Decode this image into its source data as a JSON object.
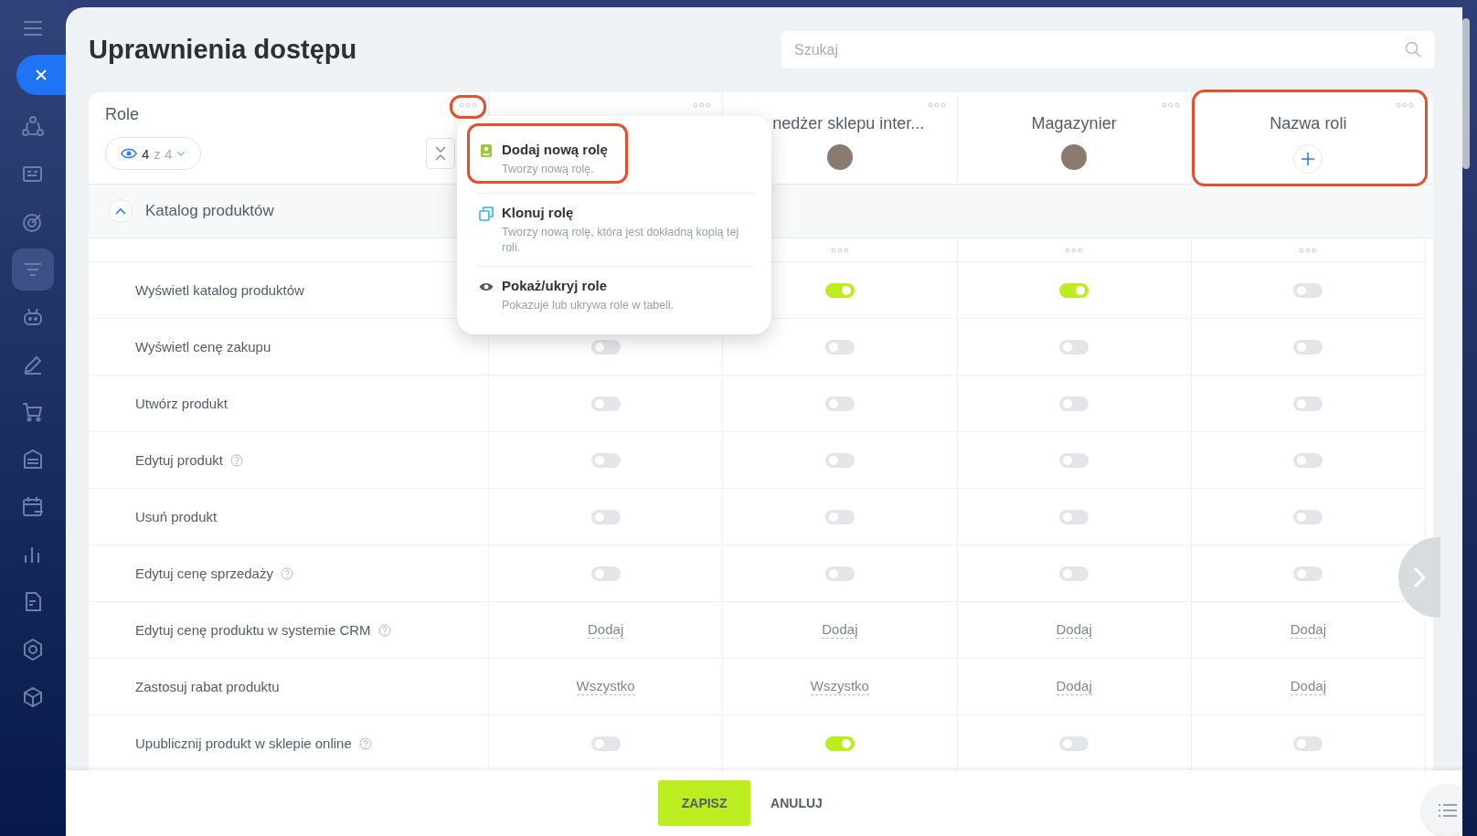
{
  "sidebar": {
    "items": [
      {
        "kind": "menu"
      },
      {
        "kind": "close"
      },
      {
        "kind": "flow"
      },
      {
        "kind": "card"
      },
      {
        "kind": "target"
      },
      {
        "kind": "filter",
        "selected": true
      },
      {
        "kind": "robot"
      },
      {
        "kind": "pen"
      },
      {
        "kind": "cart"
      },
      {
        "kind": "store"
      },
      {
        "kind": "calendar"
      },
      {
        "kind": "chart"
      },
      {
        "kind": "doc"
      },
      {
        "kind": "hexagon"
      },
      {
        "kind": "box"
      }
    ]
  },
  "title": "Uprawnienia dostępu",
  "search": {
    "placeholder": "Szukaj"
  },
  "table": {
    "roles_label": "Role",
    "visible_count": "4",
    "visible_total": "z 4",
    "roles": [
      {
        "name": "nedżer sklepu inter...",
        "kind": "assigned"
      },
      {
        "name": "Magazynier",
        "kind": "assigned"
      },
      {
        "name": "Nazwa roli",
        "kind": "empty"
      }
    ],
    "group": {
      "title": "Katalog produktów",
      "expanded": true
    },
    "rows": [
      {
        "label": "Wyświetl katalog produktów",
        "help": false,
        "cells": [
          null,
          {
            "kind": "toggle",
            "on": true
          },
          {
            "kind": "toggle",
            "on": true
          },
          {
            "kind": "toggle",
            "on": false
          }
        ]
      },
      {
        "label": "Wyświetl cenę zakupu",
        "help": false,
        "cells": [
          {
            "kind": "toggle",
            "on": false
          },
          {
            "kind": "toggle",
            "on": false
          },
          {
            "kind": "toggle",
            "on": false
          },
          {
            "kind": "toggle",
            "on": false
          }
        ]
      },
      {
        "label": "Utwórz produkt",
        "help": false,
        "cells": [
          {
            "kind": "toggle",
            "on": false
          },
          {
            "kind": "toggle",
            "on": false
          },
          {
            "kind": "toggle",
            "on": false
          },
          {
            "kind": "toggle",
            "on": false
          }
        ]
      },
      {
        "label": "Edytuj produkt",
        "help": true,
        "cells": [
          {
            "kind": "toggle",
            "on": false
          },
          {
            "kind": "toggle",
            "on": false
          },
          {
            "kind": "toggle",
            "on": false
          },
          {
            "kind": "toggle",
            "on": false
          }
        ]
      },
      {
        "label": "Usuń produkt",
        "help": false,
        "cells": [
          {
            "kind": "toggle",
            "on": false
          },
          {
            "kind": "toggle",
            "on": false
          },
          {
            "kind": "toggle",
            "on": false
          },
          {
            "kind": "toggle",
            "on": false
          }
        ]
      },
      {
        "label": "Edytuj cenę sprzedaży",
        "help": true,
        "cells": [
          {
            "kind": "toggle",
            "on": false
          },
          {
            "kind": "toggle",
            "on": false
          },
          {
            "kind": "toggle",
            "on": false
          },
          {
            "kind": "toggle",
            "on": false
          }
        ]
      },
      {
        "label": "Edytuj cenę produktu w systemie CRM",
        "help": true,
        "cells": [
          {
            "kind": "link",
            "text": "Dodaj"
          },
          {
            "kind": "link",
            "text": "Dodaj"
          },
          {
            "kind": "link",
            "text": "Dodaj"
          },
          {
            "kind": "link",
            "text": "Dodaj"
          }
        ]
      },
      {
        "label": "Zastosuj rabat produktu",
        "help": false,
        "cells": [
          {
            "kind": "link",
            "text": "Wszystko"
          },
          {
            "kind": "link",
            "text": "Wszystko"
          },
          {
            "kind": "link",
            "text": "Dodaj"
          },
          {
            "kind": "link",
            "text": "Dodaj"
          }
        ]
      },
      {
        "label": "Upublicznij produkt w sklepie online",
        "help": true,
        "cells": [
          {
            "kind": "toggle",
            "on": false
          },
          {
            "kind": "toggle",
            "on": true
          },
          {
            "kind": "toggle",
            "on": false
          },
          {
            "kind": "toggle",
            "on": false
          }
        ]
      }
    ]
  },
  "menu": {
    "items": [
      {
        "kind": "add",
        "title": "Dodaj nową rolę",
        "description": "Tworzy nową rolę.",
        "highlighted": true
      },
      {
        "kind": "clone",
        "title": "Klonuj rolę",
        "description": "Tworzy nową rolę, która jest dokładną kopią tej roli.",
        "highlighted": false
      },
      {
        "kind": "toggle-visibility",
        "title": "Pokaż/ukryj role",
        "description": "Pokazuje lub ukrywa role w tabeli.",
        "highlighted": false
      }
    ]
  },
  "footer": {
    "buttons": [
      {
        "label": "ZAPISZ",
        "kind": "primary"
      },
      {
        "label": "ANULUJ",
        "kind": "secondary"
      }
    ]
  }
}
